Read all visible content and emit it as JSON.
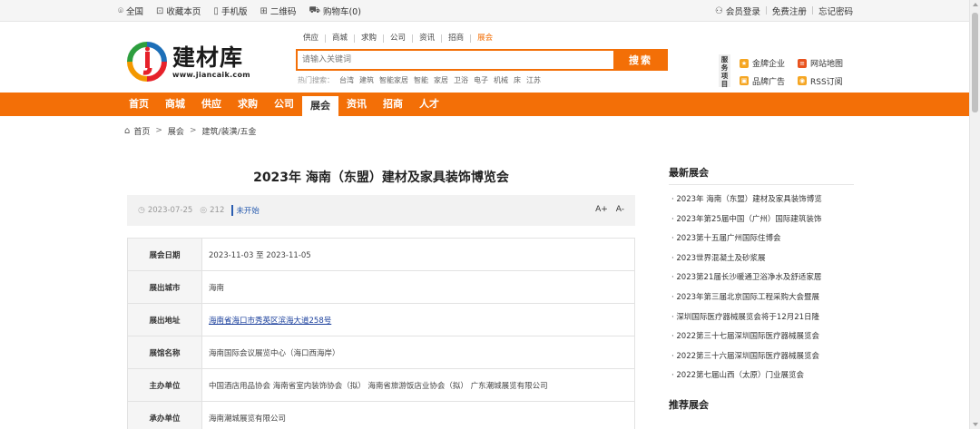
{
  "topbar": {
    "left": [
      {
        "icon": "location-icon",
        "label": "全国"
      },
      {
        "icon": "bookmark-icon",
        "label": "收藏本页"
      },
      {
        "icon": "mobile-icon",
        "label": "手机版"
      },
      {
        "icon": "qrcode-icon",
        "label": "二维码"
      },
      {
        "icon": "cart-icon",
        "label": "购物车(0)"
      }
    ],
    "right": {
      "login": "会员登录",
      "register": "免费注册",
      "forgot": "忘记密码",
      "sep": "|"
    }
  },
  "logo": {
    "name_cn": "建材库",
    "domain": "www.jiancaik.com"
  },
  "search": {
    "tabs": [
      "供应",
      "商城",
      "求购",
      "公司",
      "资讯",
      "招商",
      "展会"
    ],
    "active_tab": "展会",
    "placeholder": "请输入关键词",
    "button": "搜索",
    "hot_label": "热门搜索：",
    "hot_words": [
      "台湾",
      "建筑",
      "智能家居",
      "智能",
      "家居",
      "卫浴",
      "电子",
      "机械",
      "床",
      "江苏"
    ]
  },
  "services": {
    "tag": "服务项目",
    "items": [
      {
        "label": "金牌企业",
        "icon": "medal-icon",
        "color": "#f5a623"
      },
      {
        "label": "网站地图",
        "icon": "sitemap-icon",
        "color": "#e8531f"
      },
      {
        "label": "品牌广告",
        "icon": "brand-icon",
        "color": "#f5a623"
      },
      {
        "label": "RSS订阅",
        "icon": "rss-icon",
        "color": "#f5a623"
      }
    ]
  },
  "nav": {
    "items": [
      "首页",
      "商城",
      "供应",
      "求购",
      "公司",
      "展会",
      "资讯",
      "招商",
      "人才"
    ],
    "active": "展会"
  },
  "breadcrumb": {
    "items": [
      "首页",
      "展会",
      "建筑/装潢/五金"
    ],
    "sep": ">"
  },
  "article": {
    "title": "2023年 海南（东盟）建材及家具装饰博览会",
    "date": "2023-07-25",
    "views": "212",
    "status": "未开始",
    "font_up": "A+",
    "font_down": "A-",
    "rows": [
      {
        "key": "展会日期",
        "value": "2023-11-03 至 2023-11-05"
      },
      {
        "key": "展出城市",
        "value": "海南"
      },
      {
        "key": "展出地址",
        "value": "海南省海口市秀英区滨海大道258号",
        "link": true
      },
      {
        "key": "展馆名称",
        "value": "海南国际会议展览中心（海口西海岸）"
      },
      {
        "key": "主办单位",
        "value": "中国酒店用品协会 海南省室内装饰协会（拟） 海南省旅游饭店业协会（拟） 广东潮城展览有限公司"
      },
      {
        "key": "承办单位",
        "value": "海南潮城展览有限公司"
      }
    ]
  },
  "sidebar": {
    "latest_title": "最新展会",
    "latest": [
      "· 2023年 海南（东盟）建材及家具装饰博览",
      "· 2023年第25届中国（广州）国际建筑装饰",
      "· 2023第十五届广州国际住博会",
      "· 2023世界混凝土及砂浆展",
      "· 2023第21届长沙暖通卫浴净水及舒适家居",
      "· 2023年第三届北京国际工程采购大会暨展",
      "· 深圳国际医疗器械展览会将于12月21日隆",
      "· 2022第三十七届深圳国际医疗器械展览会",
      "· 2022第三十六届深圳国际医疗器械展览会",
      "· 2022第七届山西（太原）门业展览会"
    ],
    "recommend_title": "推荐展会"
  }
}
